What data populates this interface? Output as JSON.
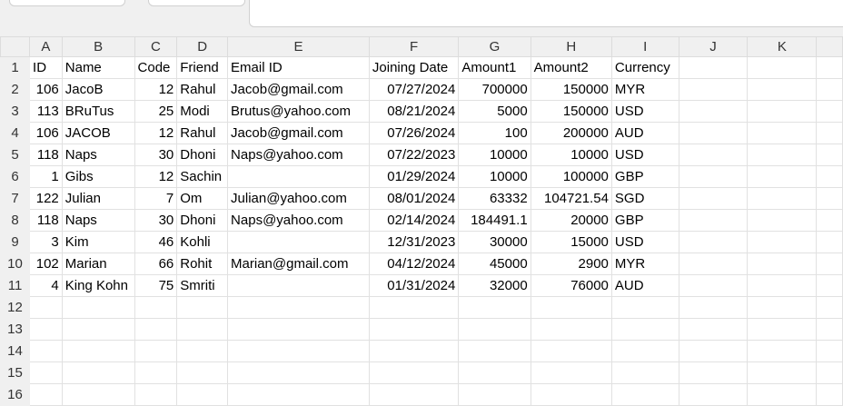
{
  "columns": [
    "A",
    "B",
    "C",
    "D",
    "E",
    "F",
    "G",
    "H",
    "I",
    "J",
    "K",
    ""
  ],
  "rows": [
    [
      "ID",
      "Name",
      "Code",
      "Friend",
      "Email ID",
      "Joining Date",
      "Amount1",
      "Amount2",
      "Currency"
    ],
    [
      "106",
      "JacoB",
      "12",
      "Rahul",
      "Jacob@gmail.com",
      "07/27/2024",
      "700000",
      "150000",
      "MYR"
    ],
    [
      "113",
      "BRuTus",
      "25",
      "Modi",
      "Brutus@yahoo.com",
      "08/21/2024",
      "5000",
      "150000",
      "USD"
    ],
    [
      "106",
      "JACOB",
      "12",
      "Rahul",
      "Jacob@gmail.com",
      "07/26/2024",
      "100",
      "200000",
      "AUD"
    ],
    [
      "118",
      "Naps",
      "30",
      "Dhoni",
      "Naps@yahoo.com",
      "07/22/2023",
      "10000",
      "10000",
      "USD"
    ],
    [
      "1",
      "Gibs",
      "12",
      "Sachin",
      "",
      "01/29/2024",
      "10000",
      "100000",
      "GBP"
    ],
    [
      "122",
      "Julian",
      "7",
      "Om",
      "Julian@yahoo.com",
      "08/01/2024",
      "63332",
      "104721.54",
      "SGD"
    ],
    [
      "118",
      "Naps",
      "30",
      "Dhoni",
      "Naps@yahoo.com",
      "02/14/2024",
      "184491.1",
      "20000",
      "GBP"
    ],
    [
      "3",
      "Kim",
      "46",
      "Kohli",
      "",
      "12/31/2023",
      "30000",
      "15000",
      "USD"
    ],
    [
      "102",
      "Marian",
      "66",
      "Rohit",
      "Marian@gmail.com",
      "04/12/2024",
      "45000",
      "2900",
      "MYR"
    ],
    [
      "4",
      "King Kohn",
      "75",
      "Smriti",
      "",
      "01/31/2024",
      "32000",
      "76000",
      "AUD"
    ]
  ],
  "total_rows": 16
}
